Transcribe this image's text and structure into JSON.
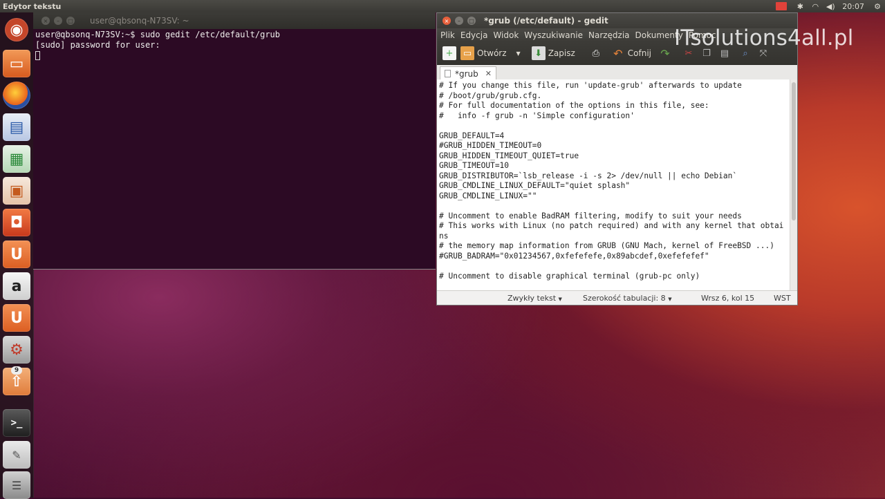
{
  "top_panel": {
    "app_title": "Edytor tekstu",
    "clock": "20:07"
  },
  "launcher": {
    "items": [
      {
        "name": "dash",
        "icon": "ubuntu-logo-icon",
        "color": "#c4462a"
      },
      {
        "name": "files",
        "icon": "folder-icon",
        "color": "#e0722e"
      },
      {
        "name": "firefox",
        "icon": "firefox-icon",
        "color": "#e87a1d"
      },
      {
        "name": "writer",
        "icon": "writer-icon",
        "color": "#2a5aa8"
      },
      {
        "name": "calc",
        "icon": "calc-icon",
        "color": "#2b8a3a"
      },
      {
        "name": "impress",
        "icon": "impress-icon",
        "color": "#c45a1e"
      },
      {
        "name": "software-center",
        "icon": "shopping-bag-icon",
        "color": "#d8502a"
      },
      {
        "name": "ubuntu-one",
        "icon": "ubuntu-one-icon",
        "color": "#e0672a"
      },
      {
        "name": "amazon",
        "icon": "amazon-icon",
        "color": "#ddd"
      },
      {
        "name": "ubuntu-one-music",
        "icon": "ubuntu-one-icon",
        "color": "#e0672a"
      },
      {
        "name": "settings",
        "icon": "gear-icon",
        "color": "#c03a2a"
      },
      {
        "name": "update-manager",
        "icon": "update-icon",
        "color": "#e0824a",
        "badge": "9"
      },
      {
        "name": "terminal",
        "icon": "terminal-icon",
        "color": "#3a3a3a"
      },
      {
        "name": "text-editor",
        "icon": "text-editor-icon",
        "color": "#bbb"
      },
      {
        "name": "workspaces",
        "icon": "trash-icon",
        "color": "#999"
      }
    ]
  },
  "terminal": {
    "title": "user@qbsonq-N73SV: ~",
    "lines": [
      "user@qbsonq-N73SV:~$ sudo gedit /etc/default/grub",
      "[sudo] password for user:"
    ]
  },
  "gedit": {
    "title": "*grub (/etc/default) - gedit",
    "menu": [
      "Plik",
      "Edycja",
      "Widok",
      "Wyszukiwanie",
      "Narzędzia",
      "Dokumenty",
      "Pomoc"
    ],
    "toolbar": {
      "open_label": "Otwórz",
      "save_label": "Zapisz",
      "undo_label": "Cofnij"
    },
    "tab_label": "*grub",
    "content": "# If you change this file, run 'update-grub' afterwards to update\n# /boot/grub/grub.cfg.\n# For full documentation of the options in this file, see:\n#   info -f grub -n 'Simple configuration'\n\nGRUB_DEFAULT=4\n#GRUB_HIDDEN_TIMEOUT=0\nGRUB_HIDDEN_TIMEOUT_QUIET=true\nGRUB_TIMEOUT=10\nGRUB_DISTRIBUTOR=`lsb_release -i -s 2> /dev/null || echo Debian`\nGRUB_CMDLINE_LINUX_DEFAULT=\"quiet splash\"\nGRUB_CMDLINE_LINUX=\"\"\n\n# Uncomment to enable BadRAM filtering, modify to suit your needs\n# This works with Linux (no patch required) and with any kernel that obtains\n# the memory map information from GRUB (GNU Mach, kernel of FreeBSD ...)\n#GRUB_BADRAM=\"0x01234567,0xfefefefe,0x89abcdef,0xefefefef\"\n\n# Uncomment to disable graphical terminal (grub-pc only)",
    "status": {
      "language": "Zwykły tekst",
      "tab_width": "Szerokość tabulacji:  8",
      "position": "Wrsz 6, kol 15",
      "insert_mode": "WST"
    }
  },
  "watermark": "ITsolutions4all.pl"
}
